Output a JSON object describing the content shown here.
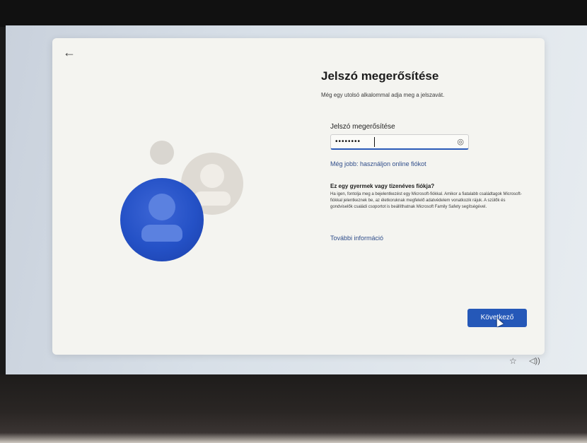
{
  "dialog": {
    "back_icon": "arrow-left-icon",
    "title": "Jelszó megerősítése",
    "subtitle": "Még egy utolsó alkalommal adja meg a jelszavát.",
    "password_label": "Jelszó megerősítése",
    "password_value": "••••••••",
    "reveal_icon": "eye-icon",
    "online_account_link": "Még jobb: használjon online fiókot",
    "child_heading": "Ez egy gyermek vagy tizenéves fiókja?",
    "child_body": "Ha igen, fontolja meg a bejelentkezést egy Microsoft-fiókkal. Amikor a fiatalabb családtagok Microsoft-fiókkal jelentkeznek be, az életkoruknak megfelelő adatvédelem vonatkozik rájuk. A szülők és gondviselők családi csoportot is beállíthatnak Microsoft Family Safety segítségével.",
    "more_info_link": "További információ",
    "next_button": "Következő"
  },
  "illustration": {
    "icons": [
      "small-dot-icon",
      "user-gray-icon",
      "user-blue-icon"
    ],
    "accent_color": "#2451c6"
  },
  "tray": {
    "accessibility_icon": "accessibility-icon",
    "volume_icon": "volume-icon"
  },
  "colors": {
    "primary_button": "#2558b8",
    "link": "#2f4d8a",
    "card_background": "#f4f4f0"
  }
}
